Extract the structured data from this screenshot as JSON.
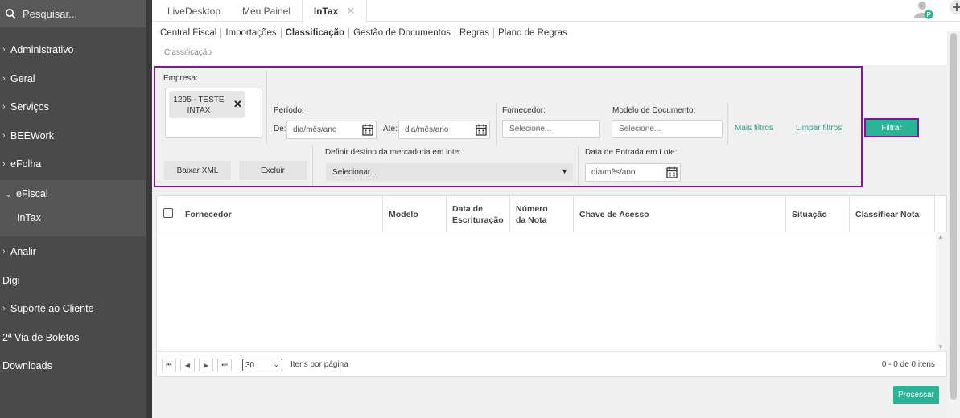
{
  "sidebar": {
    "search_placeholder": "Pesquisar...",
    "items": [
      {
        "label": "Administrativo",
        "chevron": "›"
      },
      {
        "label": "Geral",
        "chevron": "›"
      },
      {
        "label": "Serviços",
        "chevron": "›"
      },
      {
        "label": "BEEWork",
        "chevron": "›"
      },
      {
        "label": "eFolha",
        "chevron": "›"
      },
      {
        "label": "eFiscal",
        "chevron": "⌄"
      },
      {
        "label": "Analir",
        "chevron": "›"
      },
      {
        "label": "Digi",
        "chevron": ""
      },
      {
        "label": "Suporte ao Cliente",
        "chevron": "›"
      },
      {
        "label": "2ª Via de Boletos",
        "chevron": ""
      },
      {
        "label": "Downloads",
        "chevron": ""
      }
    ],
    "sub_items": [
      {
        "label": "InTax"
      }
    ]
  },
  "tabs": [
    {
      "label": "LiveDesktop"
    },
    {
      "label": "Meu Painel"
    },
    {
      "label": "InTax",
      "close": "✕"
    }
  ],
  "avatar_badge": "P",
  "subnav": [
    "Central Fiscal",
    "Importações",
    "Classificação",
    "Gestão de Documentos",
    "Regras",
    "Plano de Regras"
  ],
  "breadcrumb": "Classificação",
  "filters": {
    "empresa_label": "Empresa:",
    "empresa_chip_line1": "1295 - TESTE",
    "empresa_chip_line2": "INTAX",
    "empresa_chip_remove": "✕",
    "periodo_label": "Período:",
    "de_label": "De:",
    "ate_label": "Até:",
    "de_placeholder": "dia/mês/ano",
    "ate_placeholder": "dia/mês/ano",
    "fornecedor_label": "Fornecedor:",
    "fornecedor_placeholder": "Selecione...",
    "modelo_label": "Modelo de Documento:",
    "modelo_placeholder": "Selecione...",
    "mais_filtros": "Mais filtros",
    "limpar_filtros": "Limpar filtros",
    "baixar_xml": "Baixar XML",
    "excluir": "Excluir",
    "destino_label": "Definir destino da mercadoria em lote:",
    "destino_value": "Selecionar...",
    "destino_caret": "▼",
    "entrada_label": "Data de Entrada em Lote:",
    "entrada_placeholder": "dia/mês/ano",
    "filtrar": "Filtrar"
  },
  "table": {
    "columns": [
      "Fornecedor",
      "Modelo",
      "Data de\nEscrituração",
      "Número\nda Nota",
      "Chave de Acesso",
      "Situação",
      "Classificar Nota"
    ],
    "rows": []
  },
  "pager": {
    "first": "⏮",
    "prev": "◀",
    "next": "▶",
    "last": "⏭",
    "page_size": "30",
    "page_size_caret": "⌄",
    "per_page_label": "Itens por página",
    "range": "0 - 0 de 0 itens"
  },
  "processar": "Processar",
  "colors": {
    "accent": "#2ab394",
    "highlight": "#7b1e8c",
    "sidebar": "#4a4a4a"
  }
}
